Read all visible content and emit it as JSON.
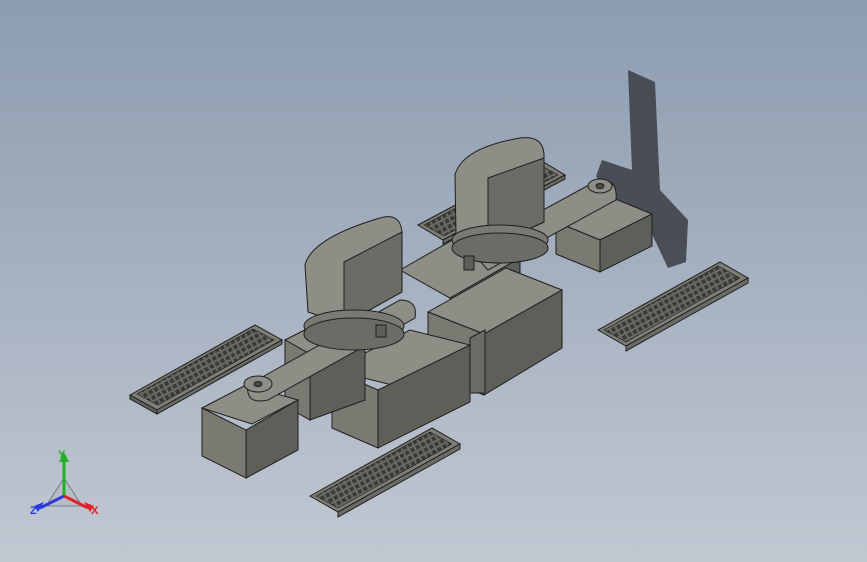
{
  "viewport": {
    "background_top": "#8d9cb0",
    "background_bottom": "#c2c8d2"
  },
  "model": {
    "part_fill": "#7e7e76",
    "part_fill_light": "#8e8e86",
    "part_fill_dark": "#5f5f59",
    "edge_color": "#1e1e1e",
    "shadow_color": "#3a3d44"
  },
  "triad": {
    "x_label": "X",
    "y_label": "Y",
    "z_label": "Z",
    "x_color": "#e0202a",
    "y_color": "#22b02a",
    "z_color": "#2a3adc"
  }
}
